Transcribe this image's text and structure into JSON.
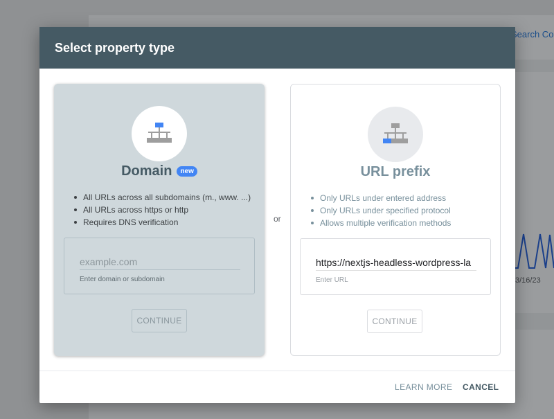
{
  "background": {
    "link_text": "Search Co",
    "date_label": "3/16/23"
  },
  "dialog": {
    "title": "Select property type",
    "separator": "or",
    "domain_card": {
      "heading": "Domain",
      "badge": "new",
      "bullets": [
        "All URLs across all subdomains (m., www. ...)",
        "All URLs across https or http",
        "Requires DNS verification"
      ],
      "input_value": "",
      "input_placeholder": "example.com",
      "input_helper": "Enter domain or subdomain",
      "continue_label": "CONTINUE",
      "icon": "sitemap-icon"
    },
    "url_card": {
      "heading": "URL prefix",
      "bullets": [
        "Only URLs under entered address",
        "Only URLs under specified protocol",
        "Allows multiple verification methods"
      ],
      "input_value": "https://nextjs-headless-wordpress-la",
      "input_placeholder": "",
      "input_helper": "Enter URL",
      "continue_label": "CONTINUE",
      "icon": "sitemap-icon"
    },
    "footer": {
      "learn_more_label": "LEARN MORE",
      "cancel_label": "CANCEL"
    }
  },
  "colors": {
    "header_bg": "#455a64",
    "domain_card_bg": "#cfd8dc",
    "accent_blue": "#4285f4"
  }
}
